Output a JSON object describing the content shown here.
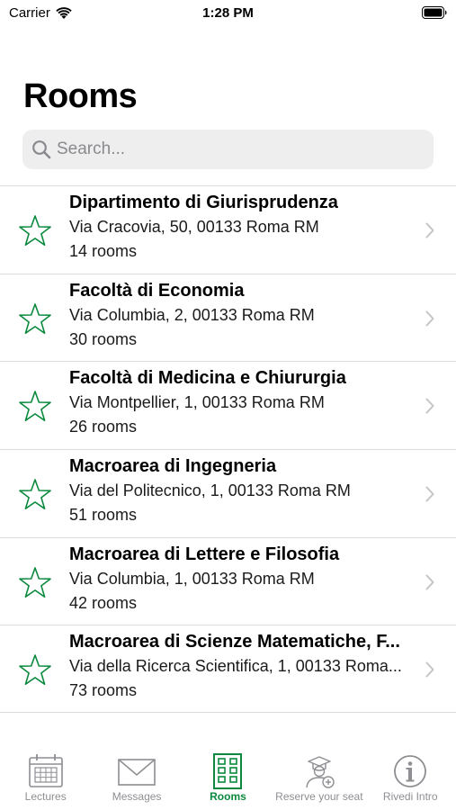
{
  "status_bar": {
    "carrier": "Carrier",
    "time": "1:28 PM"
  },
  "header": {
    "title": "Rooms"
  },
  "search": {
    "placeholder": "Search..."
  },
  "colors": {
    "accent": "#0b8a3e",
    "inactive": "#8e8e93"
  },
  "rooms": [
    {
      "name": "Dipartimento di Giurisprudenza",
      "address": "Via Cracovia, 50, 00133 Roma RM",
      "count": "14 rooms"
    },
    {
      "name": "Facoltà di Economia",
      "address": "Via Columbia, 2, 00133 Roma RM",
      "count": "30 rooms"
    },
    {
      "name": "Facoltà di Medicina e Chiururgia",
      "address": "Via Montpellier, 1, 00133 Roma RM",
      "count": "26 rooms"
    },
    {
      "name": "Macroarea di Ingegneria",
      "address": "Via del Politecnico, 1, 00133 Roma RM",
      "count": "51 rooms"
    },
    {
      "name": "Macroarea di Lettere e Filosofia",
      "address": "Via Columbia, 1, 00133 Roma RM",
      "count": "42 rooms"
    },
    {
      "name": "Macroarea di Scienze Matematiche, F...",
      "address": "Via della Ricerca Scientifica, 1, 00133 Roma...",
      "count": "73 rooms"
    }
  ],
  "tabs": [
    {
      "label": "Lectures",
      "icon": "calendar-icon"
    },
    {
      "label": "Messages",
      "icon": "envelope-icon"
    },
    {
      "label": "Rooms",
      "icon": "building-icon",
      "active": true
    },
    {
      "label": "Reserve your seat",
      "icon": "student-add-icon"
    },
    {
      "label": "Rivedi Intro",
      "icon": "info-icon"
    }
  ]
}
